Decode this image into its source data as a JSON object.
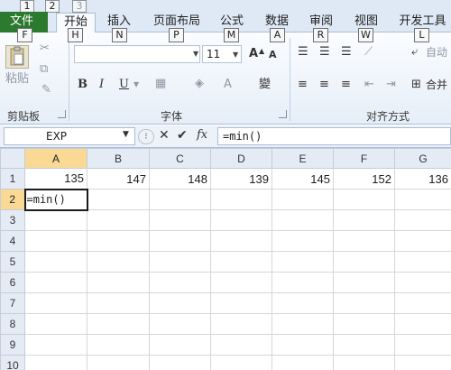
{
  "quick_access_keys": [
    "1",
    "2",
    "3"
  ],
  "tabs": [
    {
      "label": "文件",
      "key": "F"
    },
    {
      "label": "开始",
      "key": "H"
    },
    {
      "label": "插入",
      "key": "N"
    },
    {
      "label": "页面布局",
      "key": "P"
    },
    {
      "label": "公式",
      "key": "M"
    },
    {
      "label": "数据",
      "key": "A"
    },
    {
      "label": "审阅",
      "key": "R"
    },
    {
      "label": "视图",
      "key": "W"
    },
    {
      "label": "开发工具",
      "key": "L"
    }
  ],
  "ribbon": {
    "clipboard": {
      "paste_label": "粘贴",
      "group_label": "剪贴板"
    },
    "font": {
      "size": "11",
      "bold": "B",
      "italic": "I",
      "underline": "U",
      "increase_size": "A",
      "decrease_size": "A",
      "font_color": "A",
      "phonetic": "變",
      "group_label": "字体"
    },
    "alignment": {
      "wrap_label": "自动",
      "merge_label": "合并",
      "group_label": "对齐方式"
    }
  },
  "formula_bar": {
    "name_box": "EXP",
    "cancel": "✕",
    "enter": "✔",
    "fx": "fx",
    "content": "=min()"
  },
  "sheet": {
    "columns": [
      "A",
      "B",
      "C",
      "D",
      "E",
      "F",
      "G"
    ],
    "rows": [
      {
        "num": "1",
        "cells": [
          "135",
          "147",
          "148",
          "139",
          "145",
          "152",
          "136"
        ]
      },
      {
        "num": "2",
        "cells": [
          "=min()",
          "",
          "",
          "",
          "",
          "",
          ""
        ]
      },
      {
        "num": "3",
        "cells": [
          "",
          "",
          "",
          "",
          "",
          "",
          ""
        ]
      },
      {
        "num": "4",
        "cells": [
          "",
          "",
          "",
          "",
          "",
          "",
          ""
        ]
      },
      {
        "num": "5",
        "cells": [
          "",
          "",
          "",
          "",
          "",
          "",
          ""
        ]
      },
      {
        "num": "6",
        "cells": [
          "",
          "",
          "",
          "",
          "",
          "",
          ""
        ]
      },
      {
        "num": "7",
        "cells": [
          "",
          "",
          "",
          "",
          "",
          "",
          ""
        ]
      },
      {
        "num": "8",
        "cells": [
          "",
          "",
          "",
          "",
          "",
          "",
          ""
        ]
      },
      {
        "num": "9",
        "cells": [
          "",
          "",
          "",
          "",
          "",
          "",
          ""
        ]
      },
      {
        "num": "10",
        "cells": [
          "",
          "",
          "",
          "",
          "",
          "",
          ""
        ]
      }
    ]
  },
  "colors": {
    "file_tab": "#2b7a2f",
    "active_header": "#f9d993"
  }
}
